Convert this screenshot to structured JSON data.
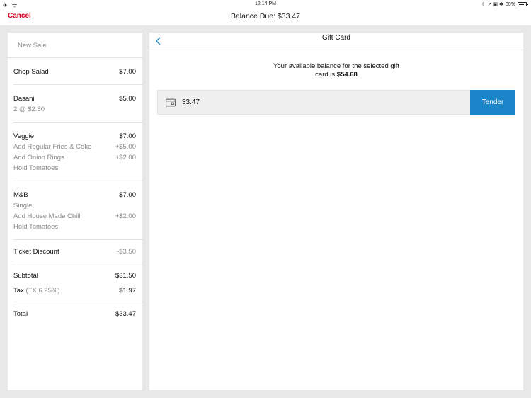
{
  "status_bar": {
    "airplane_wifi": "✈ ᯤ",
    "time": "12:14 PM",
    "indicators": "☾ ➚ ▣ ✱",
    "battery_text": "80%",
    "battery_level": 0.8
  },
  "navbar": {
    "cancel_label": "Cancel",
    "title": "Balance Due: $33.47"
  },
  "order": {
    "header": "New Sale",
    "items": [
      {
        "name": "Chop Salad",
        "price": "$7.00",
        "modifiers": []
      },
      {
        "name": "Dasani",
        "price": "$5.00",
        "modifiers": [
          {
            "name": "2 @ $2.50",
            "price": ""
          }
        ]
      },
      {
        "name": "Veggie",
        "price": "$7.00",
        "modifiers": [
          {
            "name": "Add Regular Fries & Coke",
            "price": "+$5.00"
          },
          {
            "name": "Add Onion Rings",
            "price": "+$2.00"
          },
          {
            "name": "Hold Tomatoes",
            "price": ""
          }
        ]
      },
      {
        "name": "M&B",
        "price": "$7.00",
        "modifiers": [
          {
            "name": "Single",
            "price": ""
          },
          {
            "name": "Add House Made Chilli",
            "price": "+$2.00"
          },
          {
            "name": "Hold Tomatoes",
            "price": ""
          }
        ]
      }
    ],
    "discount": {
      "label": "Ticket Discount",
      "value": "-$3.50"
    },
    "subtotal": {
      "label": "Subtotal",
      "value": "$31.50"
    },
    "tax": {
      "label": "Tax",
      "rate": "(TX 6.25%)",
      "value": "$1.97"
    },
    "total": {
      "label": "Total",
      "value": "$33.47"
    }
  },
  "gift_card": {
    "title": "Gift Card",
    "balance_line1": "Your available balance for the selected gift",
    "balance_line2_prefix": "card is ",
    "balance_amount": "$54.68",
    "amount_value": "33.47",
    "tender_label": "Tender"
  },
  "colors": {
    "accent_red": "#d0021b",
    "tender_blue": "#1a86c9"
  }
}
